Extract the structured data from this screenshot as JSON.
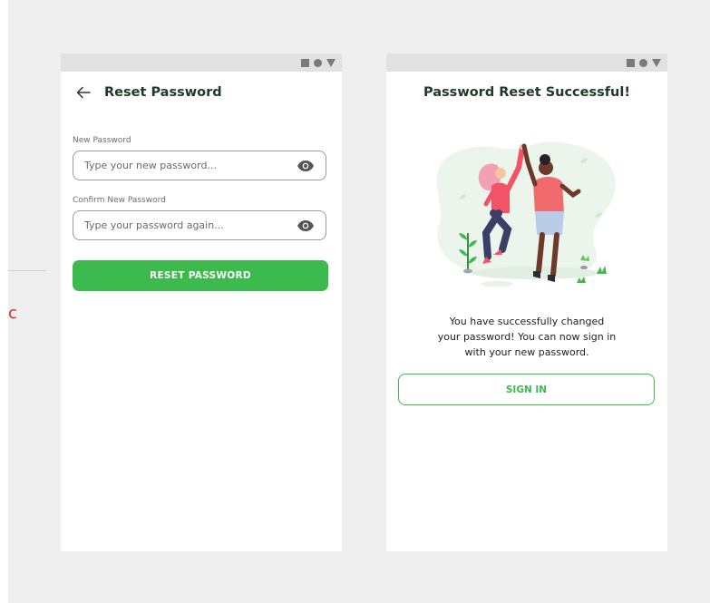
{
  "left_screen": {
    "title": "Reset Password",
    "new_password": {
      "label": "New Password",
      "placeholder": "Type your new password..."
    },
    "confirm_password": {
      "label": "Confirm New Password",
      "placeholder": "Type your password again..."
    },
    "submit_label": "RESET PASSWORD"
  },
  "right_screen": {
    "title": "Password Reset Successful!",
    "message_lines": [
      "You have successfully changed",
      "your password! You can now sign in",
      "with your new password."
    ],
    "signin_label": "SIGN IN"
  },
  "stray_text": "c",
  "colors": {
    "accent": "#3dba4e",
    "title": "#1e3a26",
    "background": "#efefef"
  },
  "icons": [
    "back-arrow-icon",
    "eye-icon",
    "square-icon",
    "circle-icon",
    "triangle-icon"
  ]
}
